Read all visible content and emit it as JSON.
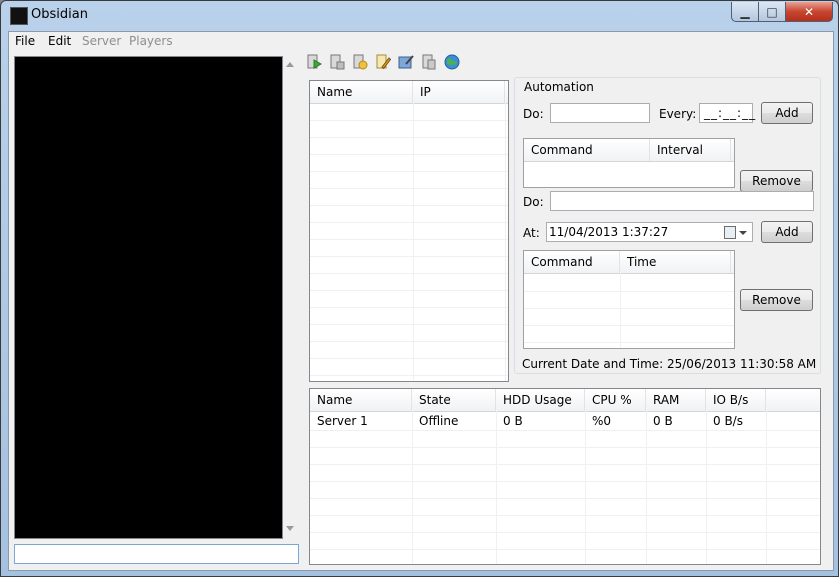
{
  "window": {
    "title": "Obsidian"
  },
  "menu": {
    "file": "File",
    "edit": "Edit",
    "server": "Server",
    "players": "Players"
  },
  "players_list": {
    "columns": [
      "Name",
      "IP"
    ]
  },
  "automation": {
    "title": "Automation",
    "do_label": "Do:",
    "every_label": "Every:",
    "every_value": "__:__:__",
    "add_label": "Add",
    "remove_label": "Remove",
    "interval_columns": [
      "Command",
      "Interval"
    ],
    "do2_label": "Do:",
    "at_label": "At:",
    "at_value": "11/04/2013   1:37:27",
    "time_columns": [
      "Command",
      "Time"
    ],
    "current_datetime": "Current Date and Time: 25/06/2013 11:30:58 AM"
  },
  "servers_table": {
    "columns": [
      "Name",
      "State",
      "HDD Usage",
      "CPU %",
      "RAM",
      "IO B/s"
    ],
    "rows": [
      [
        "Server 1",
        "Offline",
        "0 B",
        "%0",
        "0 B",
        "0 B/s"
      ]
    ]
  },
  "toolbar_icons": [
    "start-server-icon",
    "stop-server-icon",
    "restart-server-icon",
    "edit-server-icon",
    "settings-icon",
    "delete-server-icon",
    "web-icon"
  ]
}
